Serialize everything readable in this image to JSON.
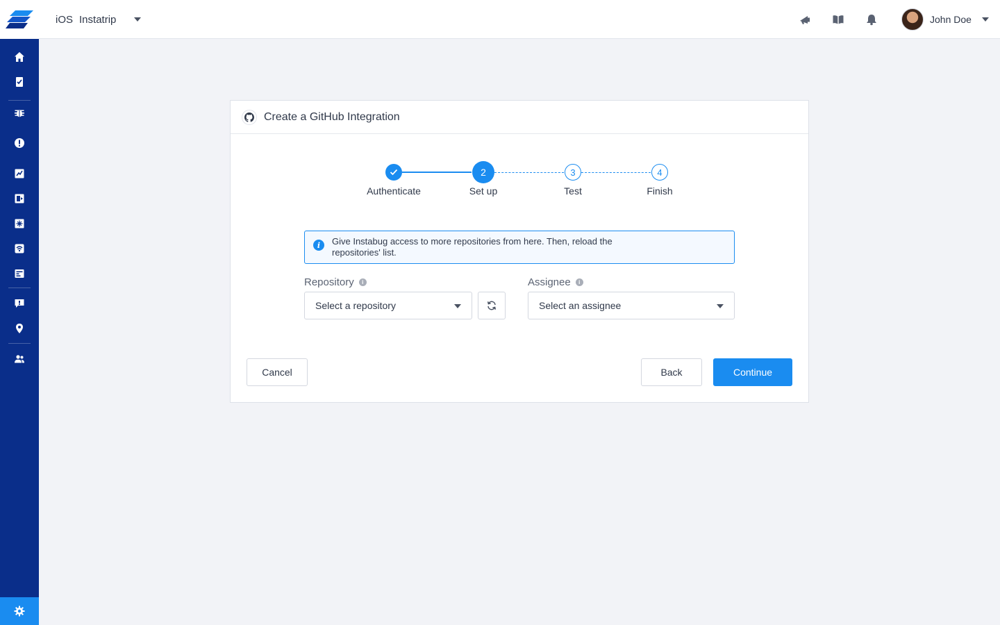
{
  "header": {
    "platform": "iOS",
    "app_name": "Instatrip",
    "icons": [
      "announcements-icon",
      "docs-book-icon",
      "notifications-bell-icon"
    ],
    "user_name": "John Doe"
  },
  "sidebar": {
    "items": [
      "home-icon",
      "reports-icon",
      "bugs-icon",
      "crashes-icon",
      "app-performance-icon",
      "session-replay-icon",
      "feature-requests-icon",
      "network-icon",
      "app-ratings-icon",
      "surveys-icon",
      "announcements-location-icon",
      "team-icon"
    ],
    "settings_icon": "settings-gear-icon"
  },
  "dialog": {
    "title": "Create a GitHub Integration",
    "steps": [
      {
        "label": "Authenticate",
        "number": "1",
        "state": "done"
      },
      {
        "label": "Set up",
        "number": "2",
        "state": "active"
      },
      {
        "label": "Test",
        "number": "3",
        "state": "todo"
      },
      {
        "label": "Finish",
        "number": "4",
        "state": "todo"
      }
    ],
    "info_text": "Give Instabug access to more repositories from here. Then, reload the repositories' list.",
    "repository": {
      "label": "Repository",
      "placeholder": "Select a repository"
    },
    "assignee": {
      "label": "Assignee",
      "placeholder": "Select an assignee"
    },
    "cancel_label": "Cancel",
    "back_label": "Back",
    "continue_label": "Continue"
  },
  "colors": {
    "sidebar": "#0a2e8a",
    "accent": "#1a8cf0",
    "background": "#f2f3f7"
  }
}
